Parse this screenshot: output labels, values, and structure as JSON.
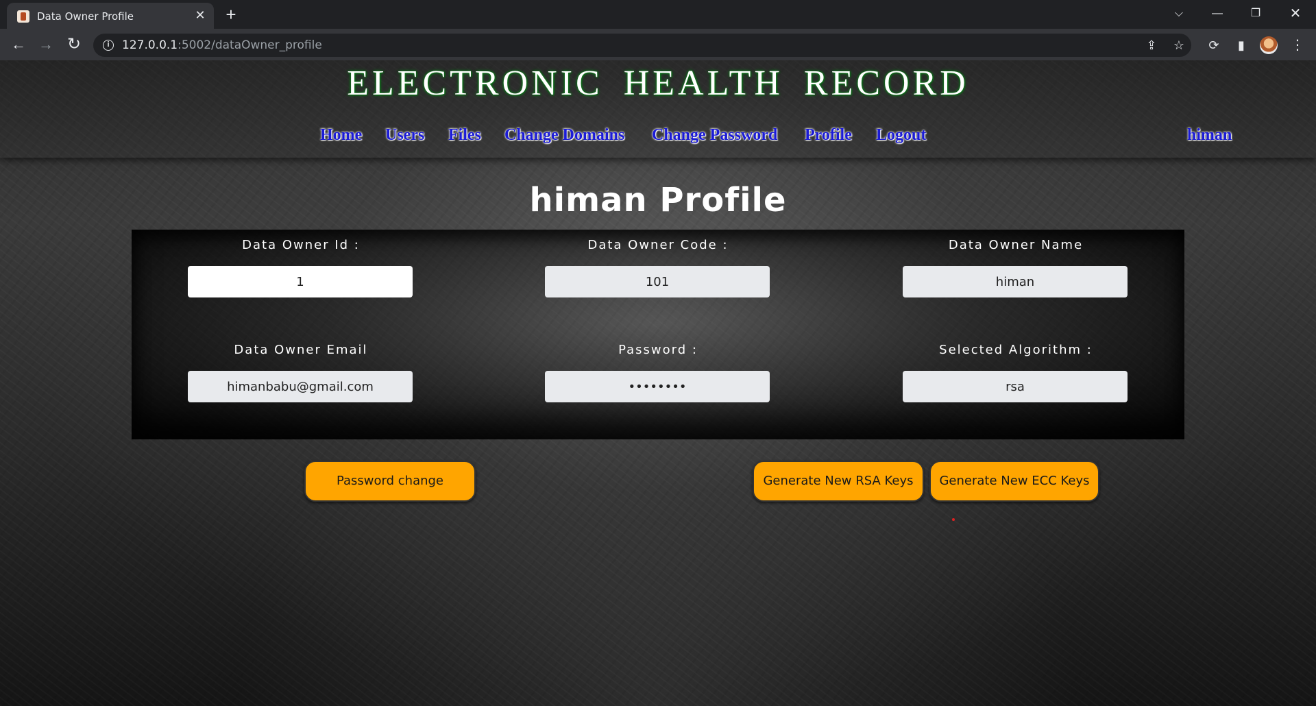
{
  "browser": {
    "tab_title": "Data Owner Profile",
    "tab_close": "✕",
    "new_tab": "+",
    "url_host": "127.0.0.1",
    "url_path": ":5002/dataOwner_profile"
  },
  "header": {
    "site_title": "ELECTRONIC HEALTH RECORD",
    "nav": {
      "home": "Home",
      "users": "Users",
      "files": "Files",
      "change_domains": "Change Domains",
      "change_password": "Change Password",
      "profile": "Profile",
      "logout": "Logout",
      "username": "himan"
    }
  },
  "main": {
    "title": "himan Profile",
    "fields": {
      "owner_id": {
        "label": "Data Owner Id :",
        "value": "1"
      },
      "owner_code": {
        "label": "Data Owner Code :",
        "value": "101"
      },
      "owner_name": {
        "label": "Data Owner Name",
        "value": "himan"
      },
      "owner_email": {
        "label": "Data Owner Email",
        "value": "himanbabu@gmail.com"
      },
      "password": {
        "label": "Password :",
        "value": "••••••••"
      },
      "algorithm": {
        "label": "Selected Algorithm :",
        "value": "rsa"
      }
    },
    "buttons": {
      "password_change": "Password change",
      "generate_rsa": "Generate New RSA Keys",
      "generate_ecc": "Generate New ECC Keys"
    }
  },
  "colors": {
    "accent_button": "#ffa500",
    "nav_link": "#1b1bd6",
    "title_glow": "#0f8a1f"
  }
}
